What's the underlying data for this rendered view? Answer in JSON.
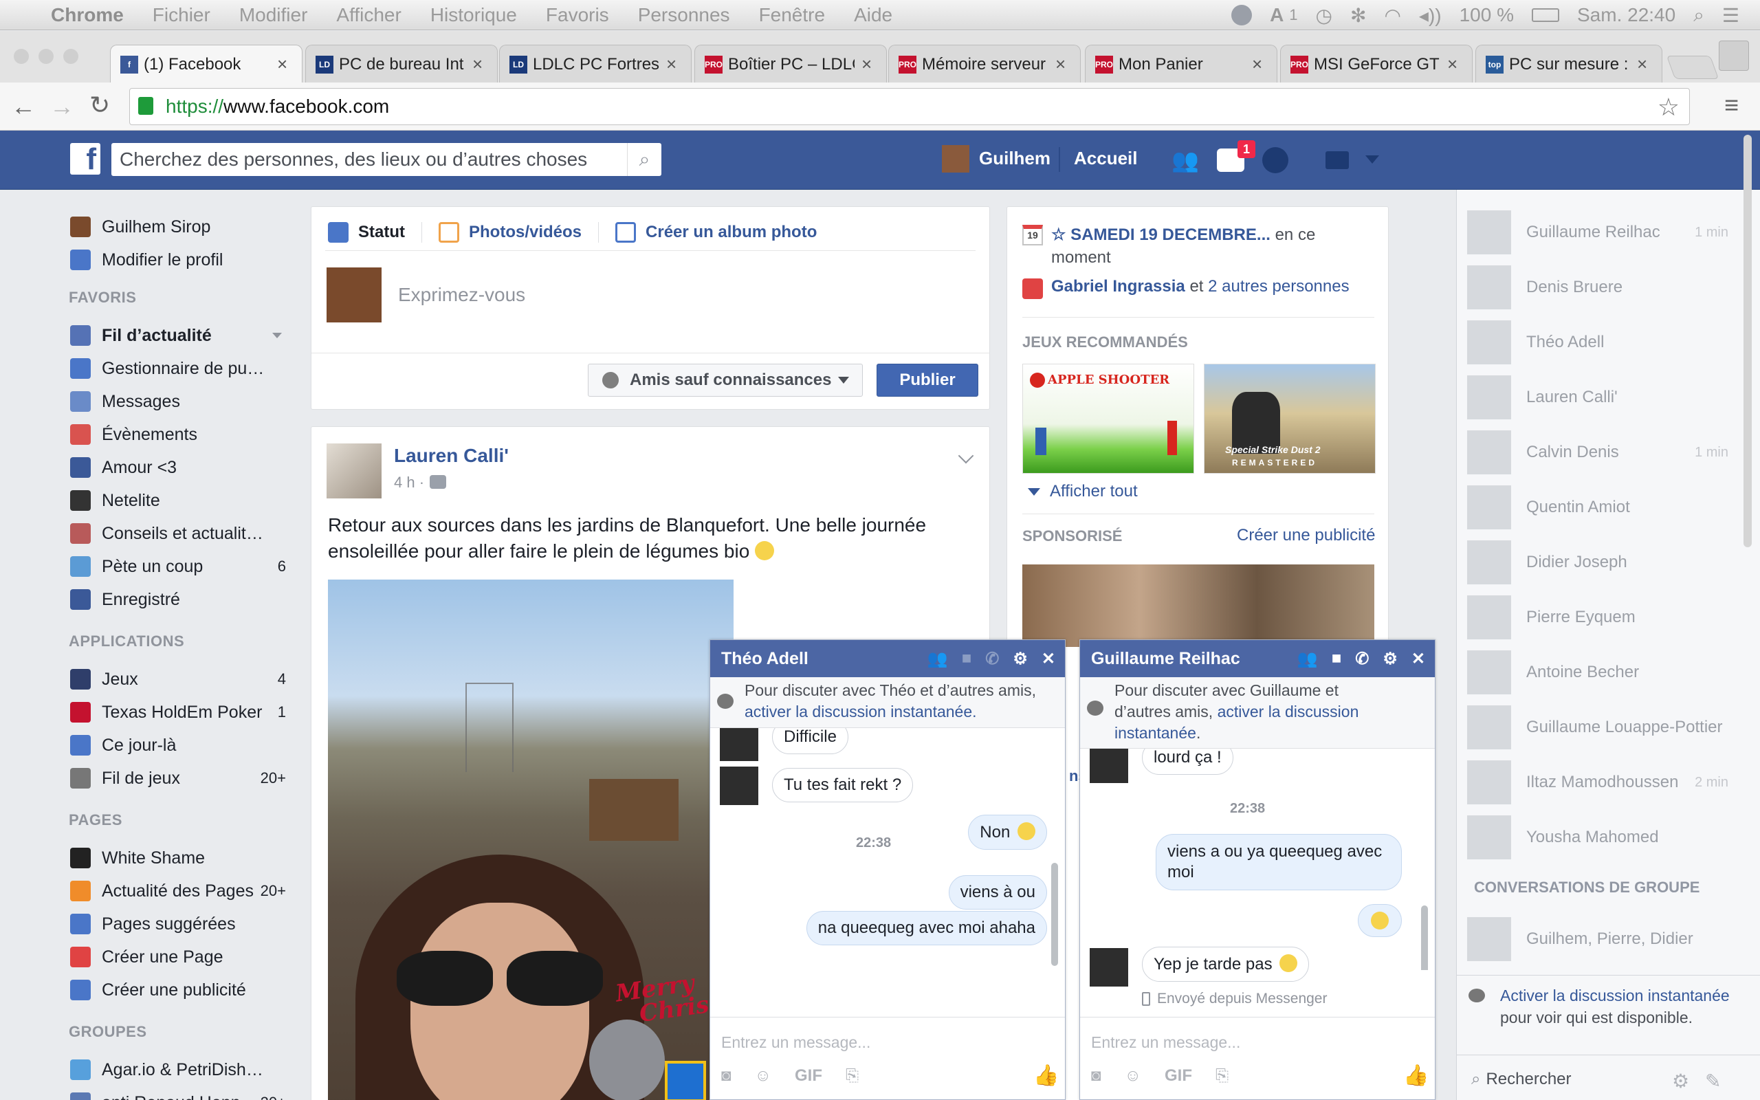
{
  "mac_menubar": {
    "app": "Chrome",
    "menus": [
      "Fichier",
      "Modifier",
      "Afficher",
      "Historique",
      "Favoris",
      "Personnes",
      "Fenêtre",
      "Aide"
    ],
    "status_badge": "1",
    "battery": "100 %",
    "clock": "Sam. 22:40"
  },
  "browser": {
    "tabs": [
      {
        "title": "(1) Facebook",
        "favicon": "f",
        "color": "#3b5998"
      },
      {
        "title": "PC de bureau Int",
        "favicon": "LD",
        "color": "#1b3a7a"
      },
      {
        "title": "LDLC PC Fortres",
        "favicon": "LD",
        "color": "#1b3a7a"
      },
      {
        "title": "Boîtier PC – LDLC",
        "favicon": "PRO",
        "color": "#c4122f"
      },
      {
        "title": "Mémoire serveur",
        "favicon": "PRO",
        "color": "#c4122f"
      },
      {
        "title": "Mon Panier",
        "favicon": "PRO",
        "color": "#c4122f"
      },
      {
        "title": "MSI GeForce GT",
        "favicon": "PRO",
        "color": "#c4122f"
      },
      {
        "title": "PC sur mesure :",
        "favicon": "top",
        "color": "#2a5c9a"
      }
    ],
    "url_scheme": "https://",
    "url_host": "www.facebook.com"
  },
  "fb_header": {
    "search_placeholder": "Cherchez des personnes, des lieux ou d’autres choses",
    "user_name": "Guilhem",
    "home": "Accueil",
    "notif_count": "1"
  },
  "left_nav": {
    "profile_name": "Guilhem Sirop",
    "edit_profile": "Modifier le profil",
    "sections": [
      {
        "heading": "FAVORIS",
        "items": [
          {
            "label": "Fil d’actualité",
            "count": ""
          },
          {
            "label": "Gestionnaire de pu…",
            "count": ""
          },
          {
            "label": "Messages",
            "count": ""
          },
          {
            "label": "Évènements",
            "count": ""
          },
          {
            "label": "Amour <3",
            "count": ""
          },
          {
            "label": "Netelite",
            "count": ""
          },
          {
            "label": "Conseils et actualit…",
            "count": ""
          },
          {
            "label": "Pète un coup",
            "count": "6"
          },
          {
            "label": "Enregistré",
            "count": ""
          }
        ]
      },
      {
        "heading": "APPLICATIONS",
        "items": [
          {
            "label": "Jeux",
            "count": "4"
          },
          {
            "label": "Texas HoldEm Poker",
            "count": "1"
          },
          {
            "label": "Ce jour-là",
            "count": ""
          },
          {
            "label": "Fil de jeux",
            "count": "20+"
          }
        ]
      },
      {
        "heading": "PAGES",
        "items": [
          {
            "label": "White Shame",
            "count": ""
          },
          {
            "label": "Actualité des Pages",
            "count": "20+"
          },
          {
            "label": "Pages suggérées",
            "count": ""
          },
          {
            "label": "Créer une Page",
            "count": ""
          },
          {
            "label": "Créer une publicité",
            "count": ""
          }
        ]
      },
      {
        "heading": "GROUPES",
        "items": [
          {
            "label": "Agar.io & PetriDish…",
            "count": ""
          },
          {
            "label": "anti Renaud Henn…",
            "count": "20+"
          }
        ]
      }
    ]
  },
  "composer": {
    "tab_status": "Statut",
    "tab_photos": "Photos/vidéos",
    "tab_album": "Créer un album photo",
    "placeholder": "Exprimez-vous",
    "audience": "Amis sauf connaissances",
    "publish": "Publier"
  },
  "post": {
    "author": "Lauren Calli'",
    "time": "4 h ·",
    "text_line1": "Retour aux sources dans les jardins de Blanquefort. Une belle journée",
    "text_line2": "ensoleillée pour aller faire le plein de légumes bio",
    "image_caption_1": "Merry",
    "image_caption_2": "Christmas"
  },
  "right_col": {
    "event_day": "19",
    "event_title": "☆ SAMEDI 19 DECEMBRE...",
    "event_suffix": "en ce",
    "event_line2": "moment",
    "birthday_name": "Gabriel Ingrassia",
    "birthday_mid": "et",
    "birthday_others": "2 autres personnes",
    "games_heading": "JEUX RECOMMANDÉS",
    "game1": "APPLE SHOOTER",
    "game2_line1": "Special Strike Dust 2",
    "game2_line2": "REMASTERED",
    "show_all": "Afficher tout",
    "sponsored": "SPONSORISÉ",
    "create_ad": "Créer une publicité"
  },
  "chat_sidebar": {
    "contacts": [
      {
        "name": "Guillaume Reilhac",
        "time": "1 min"
      },
      {
        "name": "Denis Bruere",
        "time": ""
      },
      {
        "name": "Théo Adell",
        "time": ""
      },
      {
        "name": "Lauren Calli'",
        "time": ""
      },
      {
        "name": "Calvin Denis",
        "time": "1 min"
      },
      {
        "name": "Quentin Amiot",
        "time": ""
      },
      {
        "name": "Didier Joseph",
        "time": ""
      },
      {
        "name": "Pierre Eyquem",
        "time": ""
      },
      {
        "name": "Antoine Becher",
        "time": ""
      },
      {
        "name": "Guillaume Louappe-Pottier",
        "time": ""
      },
      {
        "name": "Iltaz Mamodhoussen",
        "time": "2 min"
      },
      {
        "name": "Yousha Mahomed",
        "time": ""
      }
    ],
    "group_heading": "CONVERSATIONS DE GROUPE",
    "group_name": "Guilhem, Pierre, Didier",
    "enable_link": "Activer la discussion instantanée",
    "enable_rest": "pour voir qui est disponible.",
    "search_placeholder": "Rechercher"
  },
  "chat1": {
    "name": "Théo Adell",
    "notice": "Pour discuter avec Théo et d’autres amis,",
    "notice_link": "activer la discussion instantanée.",
    "msgs": {
      "m1": "Difficile",
      "m2": "Tu tes fait rekt ?",
      "m3": "Non",
      "time": "22:38",
      "m4": "viens à ou",
      "m5": "na queequeg avec moi ahaha"
    },
    "input_placeholder": "Entrez un message...",
    "gif": "GIF"
  },
  "chat2": {
    "name": "Guillaume Reilhac",
    "notice_1": "Pour discuter avec Guillaume et",
    "notice_2": "d’autres amis,",
    "notice_link_1": "activer la discussion",
    "notice_link_2": "instantanée",
    "notice_end": ".",
    "msgs": {
      "m1": "lourd ça !",
      "time": "22:38",
      "m2a": "viens a ou ya queequeg avec",
      "m2b": "moi",
      "m4": "Yep je tarde pas",
      "sent": "Envoyé depuis Messenger"
    },
    "input_placeholder": "Entrez un message...",
    "gif": "GIF"
  },
  "colors": {
    "fb_blue": "#3b5998",
    "chat_header": "#4c66a4",
    "link": "#365899"
  }
}
